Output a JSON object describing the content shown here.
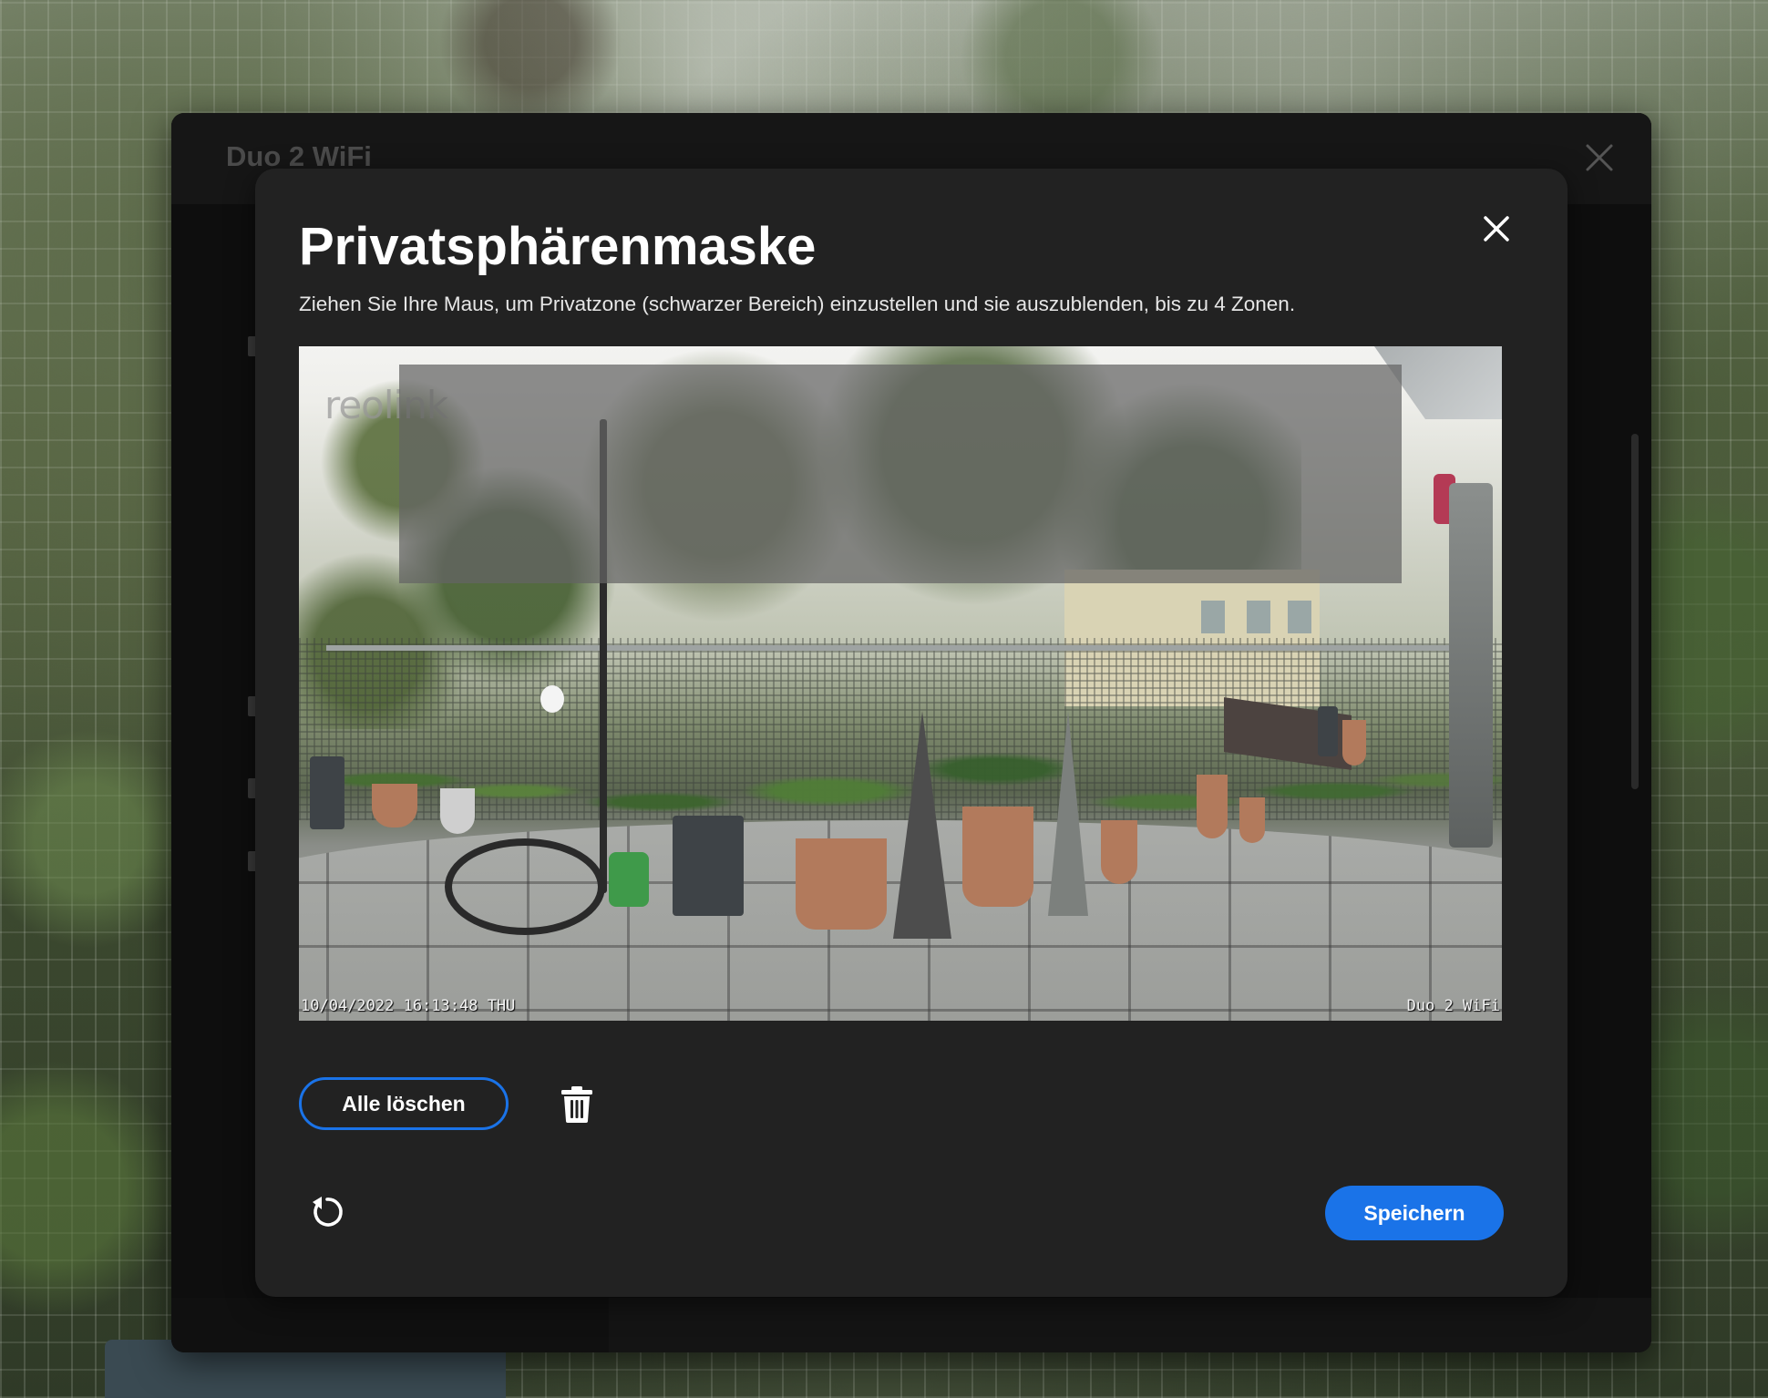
{
  "background_window": {
    "title": "Duo 2 WiFi",
    "close_icon": "close-icon"
  },
  "dialog": {
    "title": "Privatsphärenmaske",
    "description": "Ziehen Sie Ihre Maus, um Privatzone (schwarzer Bereich) einzustellen und sie auszublenden, bis zu 4 Zonen.",
    "close_icon": "close-icon",
    "camera": {
      "logo": "reolink",
      "timestamp": "10/04/2022 16:13:48 THU",
      "camera_name": "Duo 2 WiFi",
      "privacy_zone_color": "#646464",
      "max_zones": 4
    },
    "buttons": {
      "clear_all": "Alle löschen",
      "delete_icon": "trash-icon",
      "reset_icon": "reset-icon",
      "save": "Speichern"
    }
  },
  "colors": {
    "accent": "#1a73e8",
    "dialog_bg": "#222222",
    "outer_bg": "#0e0e0e"
  }
}
